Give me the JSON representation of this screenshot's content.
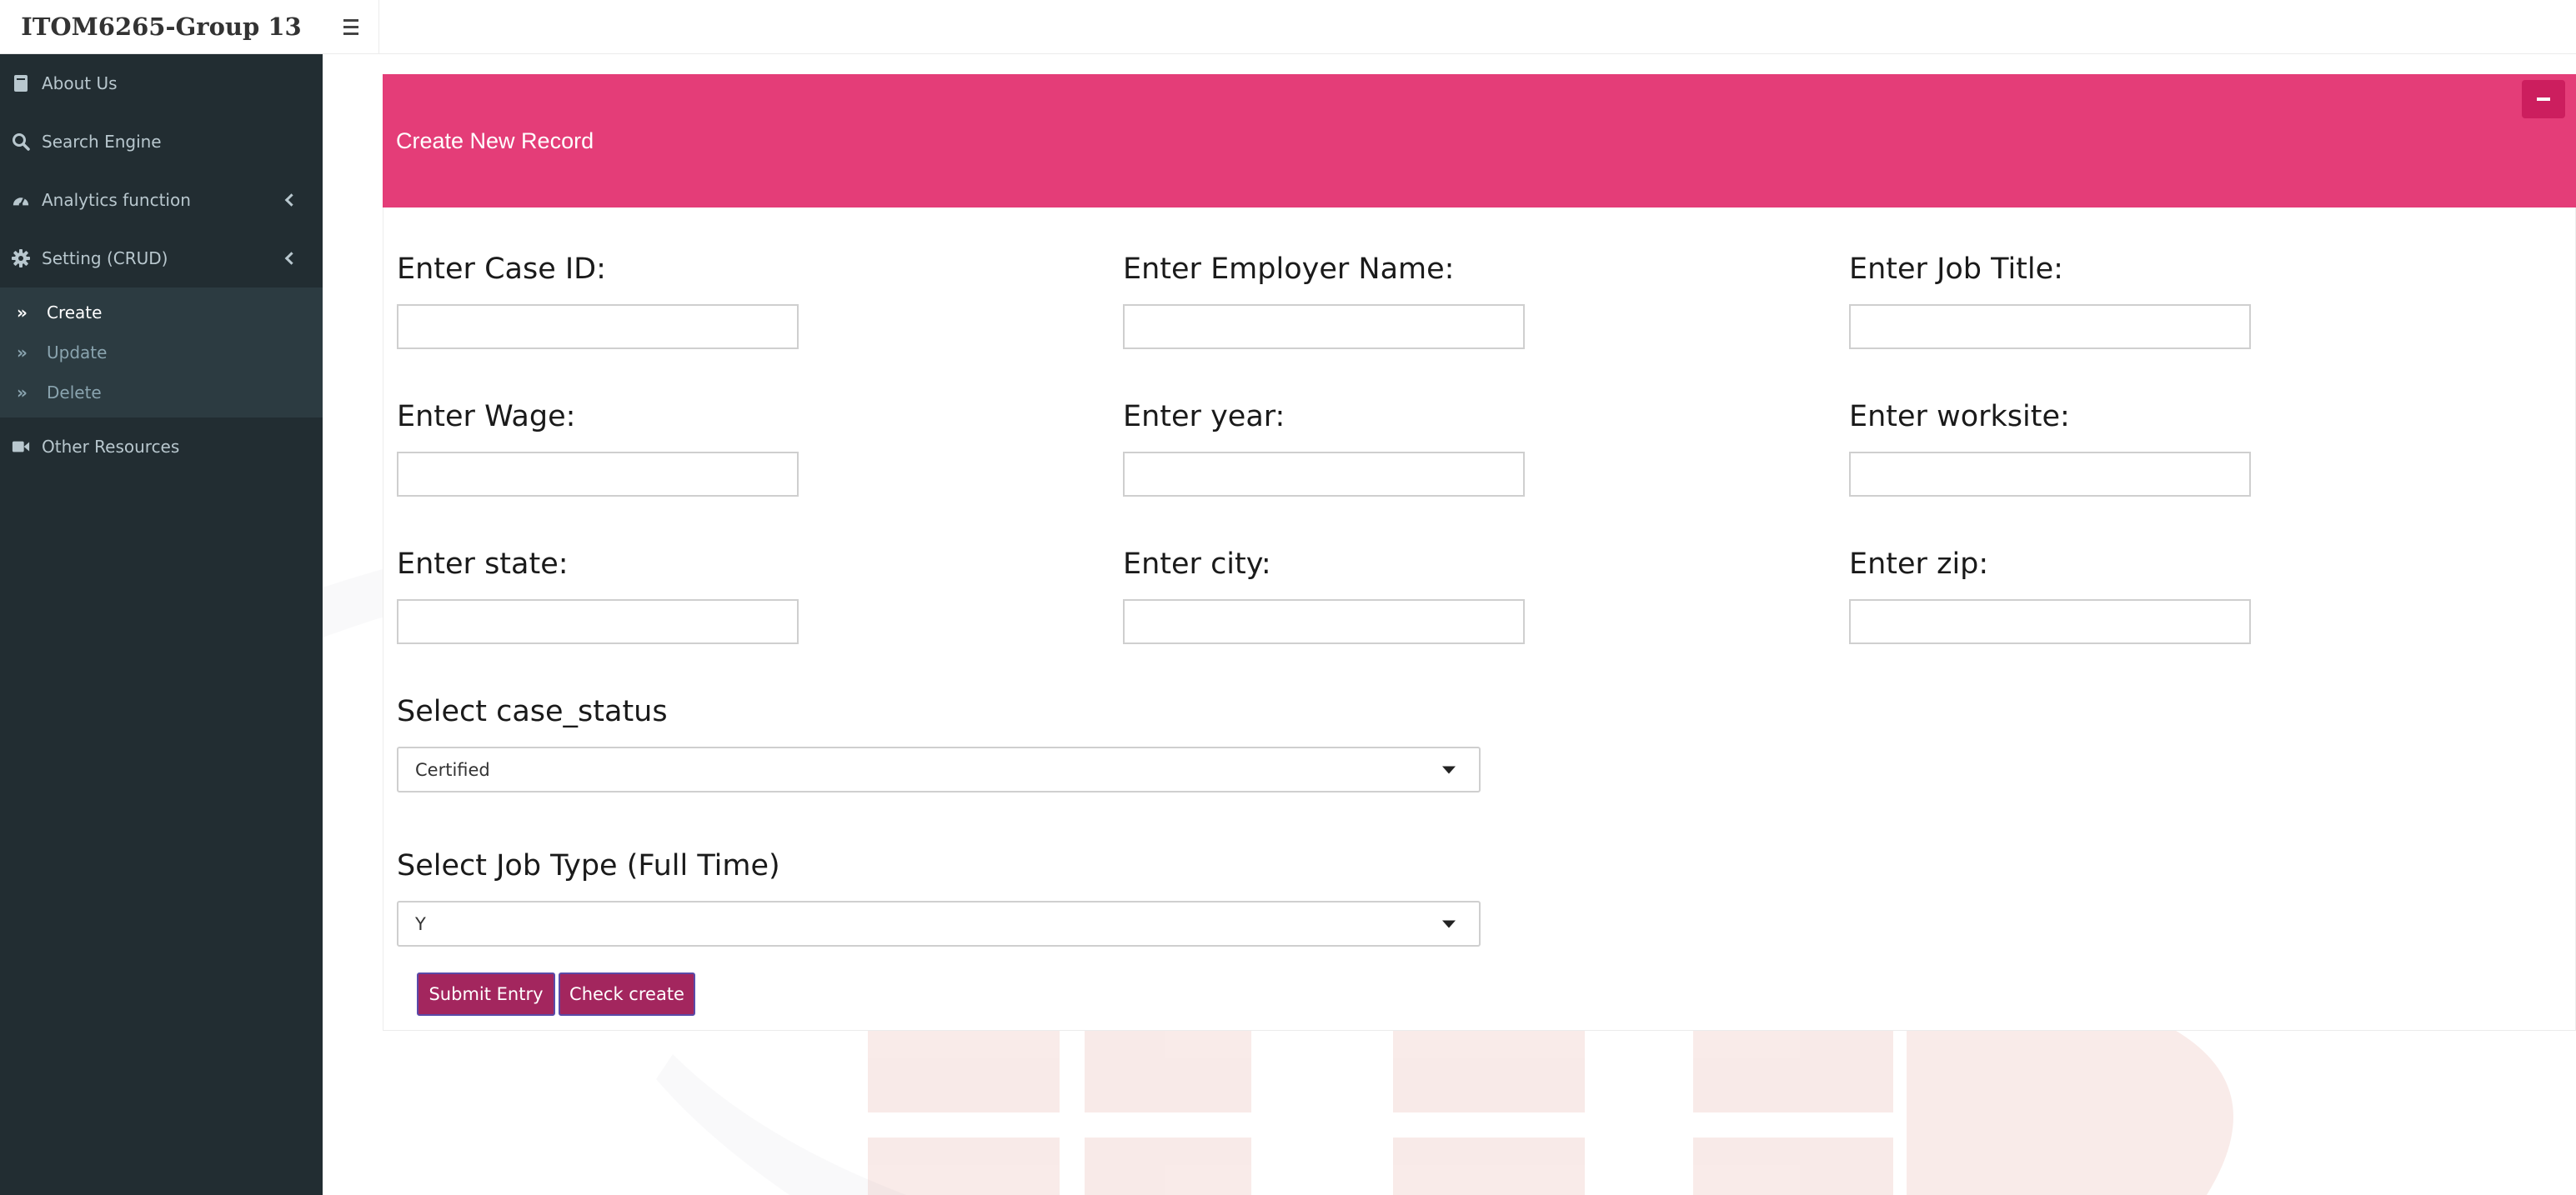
{
  "app": {
    "title": "ITOM6265-Group 13"
  },
  "colors": {
    "header": "#e43d78",
    "collapse": "#cc1e5e",
    "sidebar": "#222d32",
    "button": "#a3265e"
  },
  "sidebar": {
    "items": [
      {
        "label": "About Us",
        "icon": "book-icon"
      },
      {
        "label": "Search Engine",
        "icon": "search-icon"
      },
      {
        "label": "Analytics function",
        "icon": "dashboard-icon"
      },
      {
        "label": "Setting (CRUD)",
        "icon": "gear-icon"
      },
      {
        "label": "Other Resources",
        "icon": "video-icon"
      }
    ],
    "submenu": [
      {
        "label": "Create",
        "active": true
      },
      {
        "label": "Update",
        "active": false
      },
      {
        "label": "Delete",
        "active": false
      }
    ]
  },
  "box": {
    "title": "Create New Record"
  },
  "form": {
    "fields": [
      {
        "label": "Enter Case ID:",
        "value": ""
      },
      {
        "label": "Enter Employer Name:",
        "value": ""
      },
      {
        "label": "Enter Job Title:",
        "value": ""
      },
      {
        "label": "Enter Wage:",
        "value": ""
      },
      {
        "label": "Enter year:",
        "value": ""
      },
      {
        "label": "Enter worksite:",
        "value": ""
      },
      {
        "label": "Enter state:",
        "value": ""
      },
      {
        "label": "Enter city:",
        "value": ""
      },
      {
        "label": "Enter zip:",
        "value": ""
      }
    ],
    "case_status": {
      "label": "Select case_status",
      "value": "Certified"
    },
    "job_type": {
      "label": "Select Job Type (Full Time)",
      "value": "Y"
    },
    "submit_label": "Submit Entry",
    "check_label": "Check create"
  }
}
